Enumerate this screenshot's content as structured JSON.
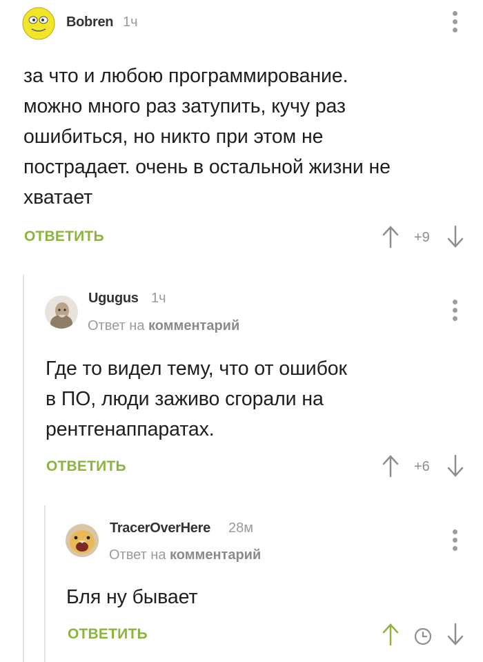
{
  "comments": [
    {
      "author": "Bobren",
      "time": "1ч",
      "lines": [
        "за что и любою программирование.",
        "можно много раз затупить, кучу раз",
        "ошибиться, но никто при этом не",
        "пострадает. очень в остальной жизни не",
        "хватает"
      ],
      "reply_label": "ОТВЕТИТЬ",
      "rating": "+9"
    },
    {
      "author": "Ugugus",
      "time": "1ч",
      "reply_prefix": "Ответ на",
      "reply_target": "комментарий",
      "lines": [
        "Где то видел тему, что от ошибок",
        "в ПО, люди заживо сгорали на",
        "рентгенаппаратах."
      ],
      "reply_label": "ОТВЕТИТЬ",
      "rating": "+6"
    },
    {
      "author": "TracerOverHere",
      "time": "28м",
      "reply_prefix": "Ответ на",
      "reply_target": "комментарий",
      "lines": [
        "Бля ну бывает"
      ],
      "reply_label": "ОТВЕТИТЬ"
    }
  ],
  "colors": {
    "accent": "#8ab43e",
    "muted": "#9a9a9a",
    "thread_line": "#e3e3e3"
  }
}
